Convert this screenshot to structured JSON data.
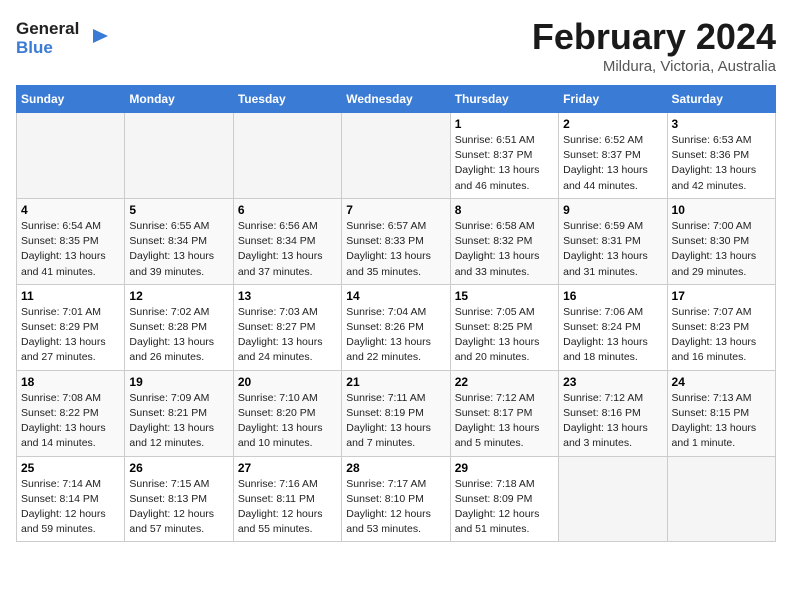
{
  "logo": {
    "line1": "General",
    "line2": "Blue"
  },
  "title": "February 2024",
  "subtitle": "Mildura, Victoria, Australia",
  "days_of_week": [
    "Sunday",
    "Monday",
    "Tuesday",
    "Wednesday",
    "Thursday",
    "Friday",
    "Saturday"
  ],
  "weeks": [
    {
      "days": [
        {
          "date": "",
          "info": ""
        },
        {
          "date": "",
          "info": ""
        },
        {
          "date": "",
          "info": ""
        },
        {
          "date": "",
          "info": ""
        },
        {
          "date": "1",
          "info": "Sunrise: 6:51 AM\nSunset: 8:37 PM\nDaylight: 13 hours\nand 46 minutes."
        },
        {
          "date": "2",
          "info": "Sunrise: 6:52 AM\nSunset: 8:37 PM\nDaylight: 13 hours\nand 44 minutes."
        },
        {
          "date": "3",
          "info": "Sunrise: 6:53 AM\nSunset: 8:36 PM\nDaylight: 13 hours\nand 42 minutes."
        }
      ]
    },
    {
      "days": [
        {
          "date": "4",
          "info": "Sunrise: 6:54 AM\nSunset: 8:35 PM\nDaylight: 13 hours\nand 41 minutes."
        },
        {
          "date": "5",
          "info": "Sunrise: 6:55 AM\nSunset: 8:34 PM\nDaylight: 13 hours\nand 39 minutes."
        },
        {
          "date": "6",
          "info": "Sunrise: 6:56 AM\nSunset: 8:34 PM\nDaylight: 13 hours\nand 37 minutes."
        },
        {
          "date": "7",
          "info": "Sunrise: 6:57 AM\nSunset: 8:33 PM\nDaylight: 13 hours\nand 35 minutes."
        },
        {
          "date": "8",
          "info": "Sunrise: 6:58 AM\nSunset: 8:32 PM\nDaylight: 13 hours\nand 33 minutes."
        },
        {
          "date": "9",
          "info": "Sunrise: 6:59 AM\nSunset: 8:31 PM\nDaylight: 13 hours\nand 31 minutes."
        },
        {
          "date": "10",
          "info": "Sunrise: 7:00 AM\nSunset: 8:30 PM\nDaylight: 13 hours\nand 29 minutes."
        }
      ]
    },
    {
      "days": [
        {
          "date": "11",
          "info": "Sunrise: 7:01 AM\nSunset: 8:29 PM\nDaylight: 13 hours\nand 27 minutes."
        },
        {
          "date": "12",
          "info": "Sunrise: 7:02 AM\nSunset: 8:28 PM\nDaylight: 13 hours\nand 26 minutes."
        },
        {
          "date": "13",
          "info": "Sunrise: 7:03 AM\nSunset: 8:27 PM\nDaylight: 13 hours\nand 24 minutes."
        },
        {
          "date": "14",
          "info": "Sunrise: 7:04 AM\nSunset: 8:26 PM\nDaylight: 13 hours\nand 22 minutes."
        },
        {
          "date": "15",
          "info": "Sunrise: 7:05 AM\nSunset: 8:25 PM\nDaylight: 13 hours\nand 20 minutes."
        },
        {
          "date": "16",
          "info": "Sunrise: 7:06 AM\nSunset: 8:24 PM\nDaylight: 13 hours\nand 18 minutes."
        },
        {
          "date": "17",
          "info": "Sunrise: 7:07 AM\nSunset: 8:23 PM\nDaylight: 13 hours\nand 16 minutes."
        }
      ]
    },
    {
      "days": [
        {
          "date": "18",
          "info": "Sunrise: 7:08 AM\nSunset: 8:22 PM\nDaylight: 13 hours\nand 14 minutes."
        },
        {
          "date": "19",
          "info": "Sunrise: 7:09 AM\nSunset: 8:21 PM\nDaylight: 13 hours\nand 12 minutes."
        },
        {
          "date": "20",
          "info": "Sunrise: 7:10 AM\nSunset: 8:20 PM\nDaylight: 13 hours\nand 10 minutes."
        },
        {
          "date": "21",
          "info": "Sunrise: 7:11 AM\nSunset: 8:19 PM\nDaylight: 13 hours\nand 7 minutes."
        },
        {
          "date": "22",
          "info": "Sunrise: 7:12 AM\nSunset: 8:17 PM\nDaylight: 13 hours\nand 5 minutes."
        },
        {
          "date": "23",
          "info": "Sunrise: 7:12 AM\nSunset: 8:16 PM\nDaylight: 13 hours\nand 3 minutes."
        },
        {
          "date": "24",
          "info": "Sunrise: 7:13 AM\nSunset: 8:15 PM\nDaylight: 13 hours\nand 1 minute."
        }
      ]
    },
    {
      "days": [
        {
          "date": "25",
          "info": "Sunrise: 7:14 AM\nSunset: 8:14 PM\nDaylight: 12 hours\nand 59 minutes."
        },
        {
          "date": "26",
          "info": "Sunrise: 7:15 AM\nSunset: 8:13 PM\nDaylight: 12 hours\nand 57 minutes."
        },
        {
          "date": "27",
          "info": "Sunrise: 7:16 AM\nSunset: 8:11 PM\nDaylight: 12 hours\nand 55 minutes."
        },
        {
          "date": "28",
          "info": "Sunrise: 7:17 AM\nSunset: 8:10 PM\nDaylight: 12 hours\nand 53 minutes."
        },
        {
          "date": "29",
          "info": "Sunrise: 7:18 AM\nSunset: 8:09 PM\nDaylight: 12 hours\nand 51 minutes."
        },
        {
          "date": "",
          "info": ""
        },
        {
          "date": "",
          "info": ""
        }
      ]
    }
  ]
}
